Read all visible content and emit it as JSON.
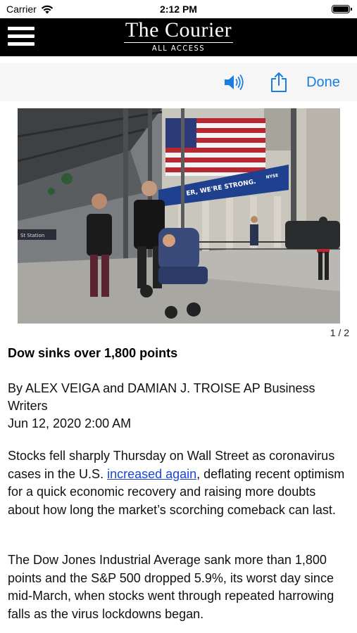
{
  "status_bar": {
    "carrier": "Carrier",
    "time": "2:12 PM"
  },
  "masthead": {
    "title": "The Courier",
    "subtitle": "ALL ACCESS",
    "menu_icon": "hamburger-menu-icon"
  },
  "toolbar": {
    "speaker_icon": "speaker-icon",
    "share_icon": "share-icon",
    "done_label": "Done",
    "accent_color": "#1a7ee0"
  },
  "gallery": {
    "counter": "1 / 2",
    "banner_text": "ER, WE'RE STRONG.",
    "banner_badge": "NYSE",
    "station_sign": "St Station"
  },
  "article": {
    "headline": "Dow sinks over 1,800 points",
    "byline": "By ALEX VEIGA and DAMIAN J. TROISE AP Business Writers",
    "date": "Jun 12, 2020 2:00 AM",
    "paragraph1_before": "Stocks fell sharply Thursday on Wall Street as coronavirus cases in the U.S. ",
    "paragraph1_link": "increased again",
    "paragraph1_after": ", deflating recent optimism for a quick economic recovery and raising more doubts about how long the market’s scorching comeback can last.",
    "paragraph2": "The Dow Jones Industrial Average sank more than 1,800 points and the S&P 500 dropped 5.9%, its worst day since mid-March, when stocks went through repeated harrowing falls as the virus lockdowns began."
  }
}
